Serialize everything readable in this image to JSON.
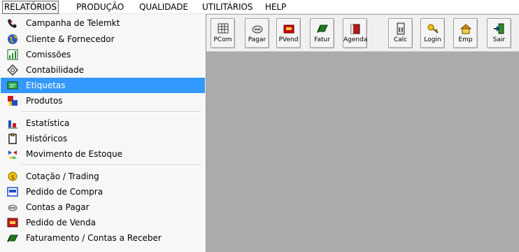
{
  "menubar": {
    "items": [
      "RELATÓRIOS",
      "PRODUÇÃO",
      "QUALIDADE",
      "UTILITÁRIOS",
      "HELP"
    ]
  },
  "toolbar": {
    "buttons": [
      {
        "label": "PCom",
        "icon": "grid-icon"
      },
      {
        "label": "Pagar",
        "icon": "money-icon"
      },
      {
        "label": "PVend",
        "icon": "register-icon"
      },
      {
        "label": "Fatur",
        "icon": "banknote-icon"
      },
      {
        "label": "Agenda",
        "icon": "book-icon"
      },
      {
        "label": "Calc",
        "icon": "calculator-icon"
      },
      {
        "label": "Login",
        "icon": "key-icon"
      },
      {
        "label": "Emp",
        "icon": "company-icon"
      },
      {
        "label": "Sair",
        "icon": "exit-icon"
      }
    ]
  },
  "dropdown": {
    "items": [
      {
        "label": "Campanha de Telemkt",
        "icon": "phone-icon"
      },
      {
        "label": "Cliente & Fornecedor",
        "icon": "globe-icon"
      },
      {
        "label": "Comissões",
        "icon": "chart-icon"
      },
      {
        "label": "Contabilidade",
        "icon": "tag-icon"
      },
      {
        "label": "Etiquetas",
        "icon": "label-icon"
      },
      {
        "label": "Produtos",
        "icon": "product-icon"
      },
      {
        "label": "Estatística",
        "icon": "stats-icon"
      },
      {
        "label": "Históricos",
        "icon": "clipboard-icon"
      },
      {
        "label": "Movimento de Estoque",
        "icon": "stock-icon"
      },
      {
        "label": "Cotação / Trading",
        "icon": "coin-icon"
      },
      {
        "label": "Pedido de Compra",
        "icon": "purchase-icon"
      },
      {
        "label": "Contas a Pagar",
        "icon": "payables-icon"
      },
      {
        "label": "Pedido de Venda",
        "icon": "sales-icon"
      },
      {
        "label": "Faturamento / Contas a Receber",
        "icon": "invoice-icon"
      }
    ],
    "selected": "Etiquetas"
  }
}
